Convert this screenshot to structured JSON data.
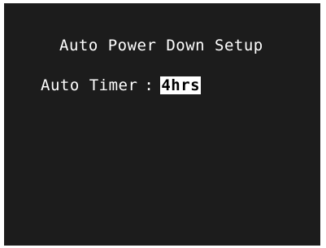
{
  "osd": {
    "title": "Auto Power Down Setup",
    "setting": {
      "label": "Auto Timer",
      "separator": ":",
      "value": "4hrs"
    },
    "colors": {
      "background": "#1c1c1c",
      "text": "#ffffff",
      "highlight_bg": "#ffffff",
      "highlight_text": "#000000"
    }
  }
}
